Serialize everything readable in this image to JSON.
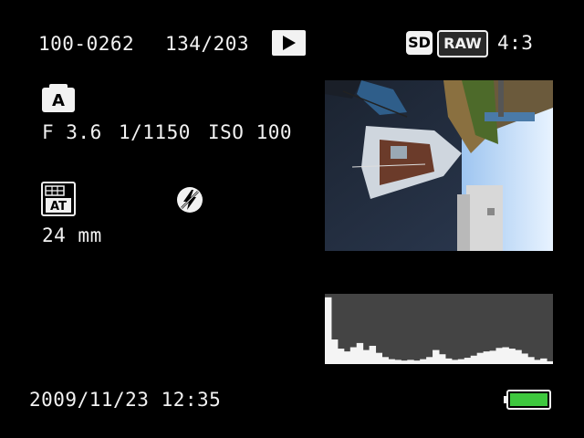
{
  "playback": {
    "file_number": "100-0262",
    "frame_counter": "134/203",
    "play_icon": "play-icon",
    "card_icon": "SD",
    "format": "RAW",
    "aspect_ratio": "4:3"
  },
  "exposure": {
    "mode_icon": "A",
    "aperture": "F 3.6",
    "shutter": "1/1150",
    "iso": "ISO 100"
  },
  "settings": {
    "scene_icon": "AT",
    "flash_icon": "flash-off-icon",
    "focal_length": "24 mm"
  },
  "footer": {
    "datetime": "2009/11/23 12:35",
    "battery_icon": "battery-full-icon",
    "battery_level": 1.0
  },
  "colors": {
    "text": "#f2f2f2",
    "background": "#000000",
    "battery": "#3ec83e",
    "histogram_bg": "#444444"
  },
  "histogram": {
    "levels": [
      0.95,
      0.35,
      0.22,
      0.18,
      0.24,
      0.3,
      0.2,
      0.26,
      0.16,
      0.1,
      0.07,
      0.06,
      0.05,
      0.06,
      0.05,
      0.07,
      0.1,
      0.2,
      0.14,
      0.08,
      0.06,
      0.07,
      0.09,
      0.12,
      0.16,
      0.18,
      0.19,
      0.23,
      0.24,
      0.22,
      0.2,
      0.15,
      0.1,
      0.06,
      0.08,
      0.04
    ]
  }
}
